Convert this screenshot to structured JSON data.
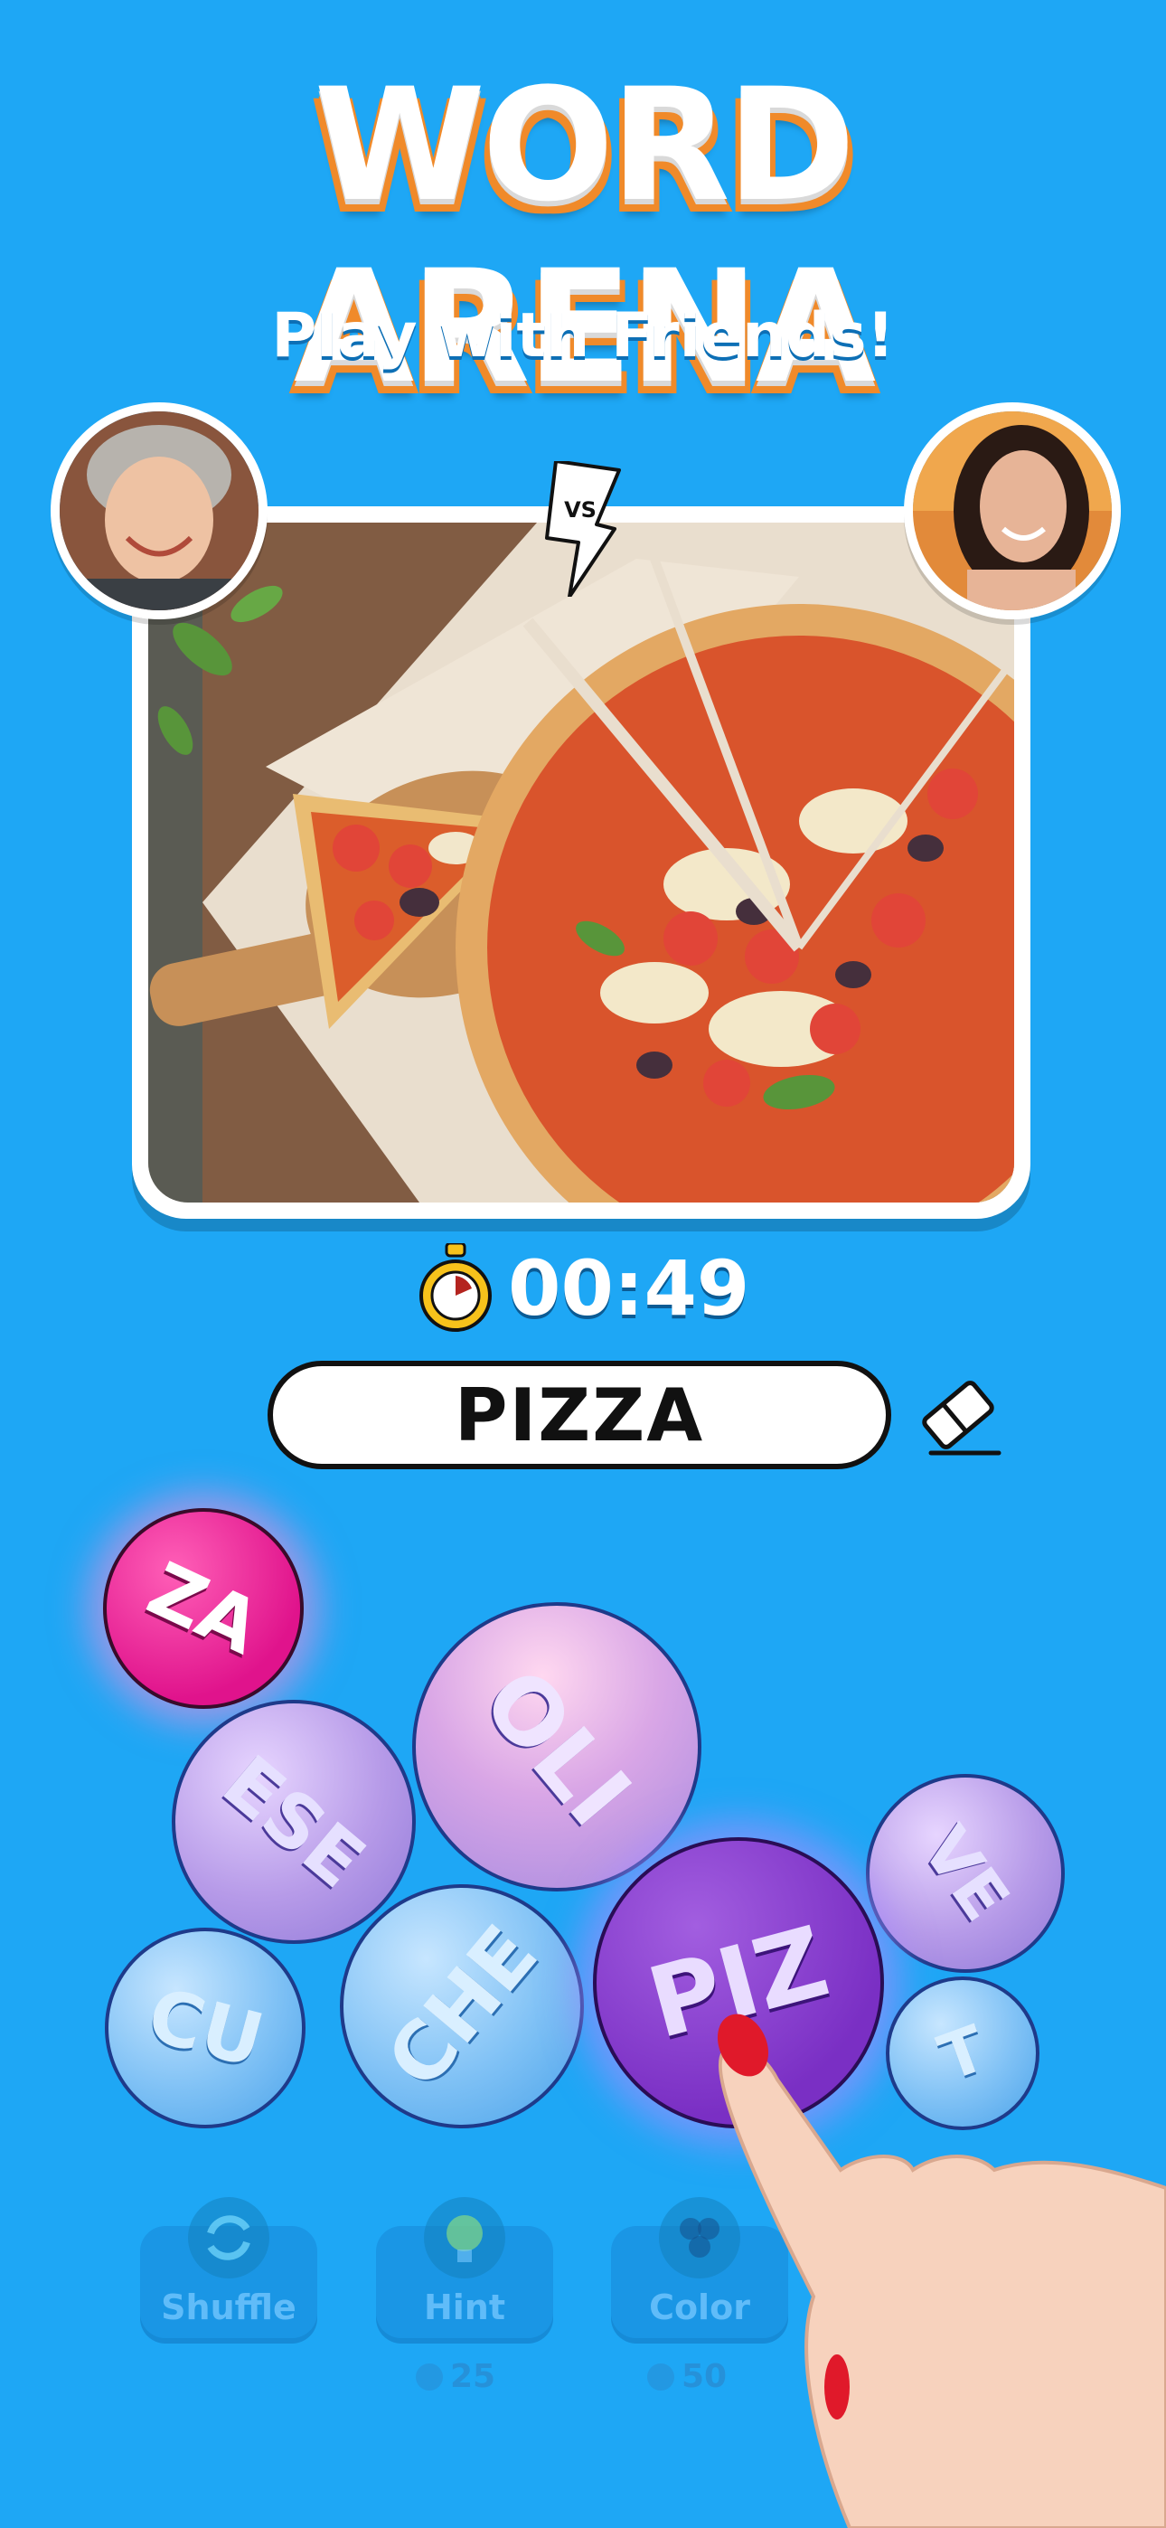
{
  "header": {
    "title": "WORD ARENA",
    "subtitle": "Play with Friends!"
  },
  "match": {
    "vs_label": "VS",
    "timer": "00:49"
  },
  "answer": {
    "word": "PIZZA"
  },
  "bubbles": [
    {
      "text": "ZA"
    },
    {
      "text": "OLI"
    },
    {
      "text": "ESE"
    },
    {
      "text": "VE"
    },
    {
      "text": "CU"
    },
    {
      "text": "CHE"
    },
    {
      "text": "PIZ"
    },
    {
      "text": "T"
    }
  ],
  "tools": [
    {
      "label": "Shuffle",
      "icon": "shuffle-icon"
    },
    {
      "label": "Hint",
      "icon": "lightbulb-icon",
      "cost": "25"
    },
    {
      "label": "Color",
      "icon": "palette-icon",
      "cost": "50"
    }
  ],
  "colors": {
    "background": "#1ea7f5",
    "accent": "#f08a2a",
    "selected": "#e0138c",
    "active": "#7a2fc4"
  }
}
